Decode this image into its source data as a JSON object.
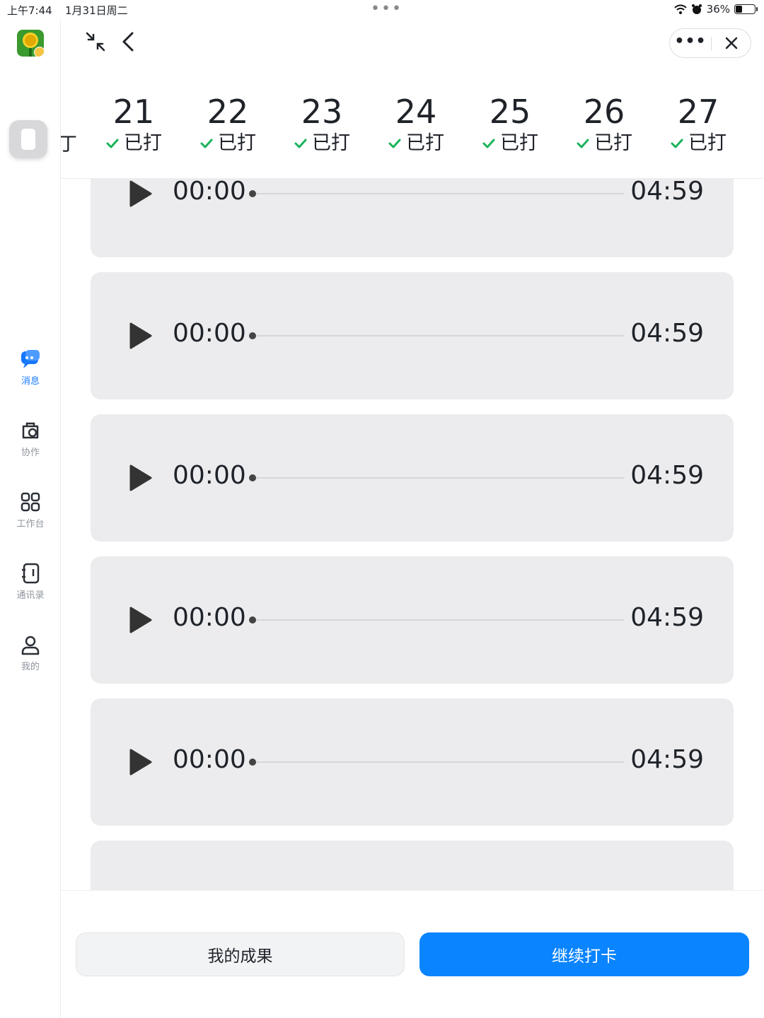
{
  "status": {
    "time": "上午7:44",
    "date": "1月31日周二",
    "battery": "36%",
    "battery_level": 0.36
  },
  "topbar": {
    "more_label": "•••"
  },
  "date_strip": {
    "partial_label": "丁",
    "days": [
      {
        "num": "21",
        "status": "已打"
      },
      {
        "num": "22",
        "status": "已打"
      },
      {
        "num": "23",
        "status": "已打"
      },
      {
        "num": "24",
        "status": "已打"
      },
      {
        "num": "25",
        "status": "已打"
      },
      {
        "num": "26",
        "status": "已打"
      },
      {
        "num": "27",
        "status": "已打"
      }
    ]
  },
  "audio_items": [
    {
      "current": "00:00",
      "duration": "04:59"
    },
    {
      "current": "00:00",
      "duration": "04:59"
    },
    {
      "current": "00:00",
      "duration": "04:59"
    },
    {
      "current": "00:00",
      "duration": "04:59"
    },
    {
      "current": "00:00",
      "duration": "04:59"
    }
  ],
  "sidebar": {
    "items": [
      {
        "label": "消息",
        "icon": "message-icon",
        "active": true
      },
      {
        "label": "协作",
        "icon": "collaboration-icon",
        "active": false
      },
      {
        "label": "工作台",
        "icon": "workbench-icon",
        "active": false
      },
      {
        "label": "通讯录",
        "icon": "contacts-icon",
        "active": false
      },
      {
        "label": "我的",
        "icon": "profile-icon",
        "active": false
      }
    ]
  },
  "bottom": {
    "secondary_label": "我的成果",
    "primary_label": "继续打卡"
  },
  "colors": {
    "accent": "#1677ff",
    "primary_button": "#0a84ff",
    "check": "#19b35a",
    "card_bg": "#ececee"
  }
}
